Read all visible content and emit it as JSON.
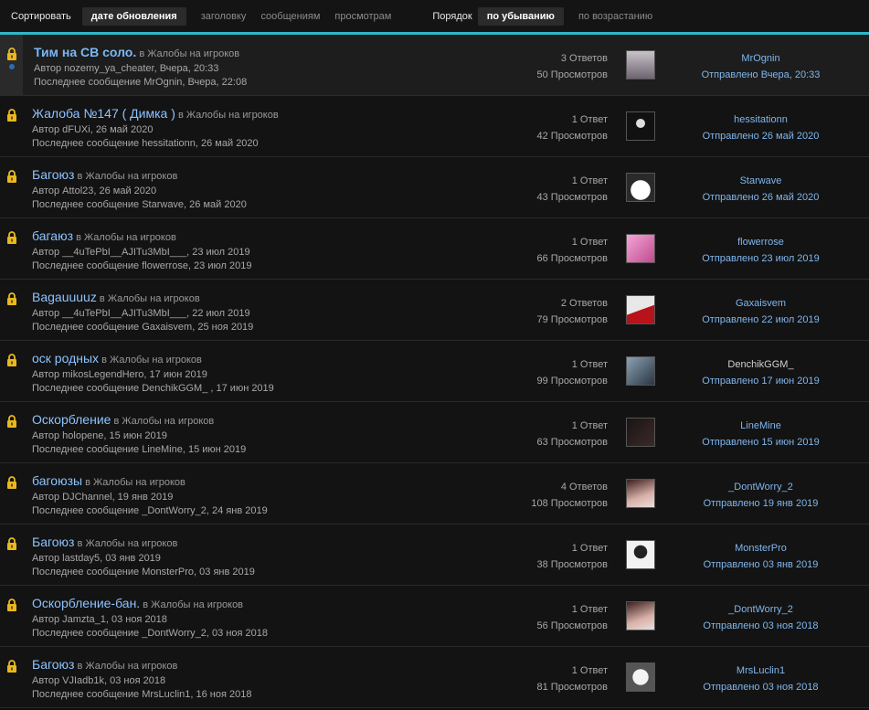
{
  "sortbar": {
    "sort_label": "Сортировать",
    "sort_options": [
      "дате обновления",
      "заголовку",
      "сообщениям",
      "просмотрам"
    ],
    "order_label": "Порядок",
    "order_options": [
      "по убыванию",
      "по возрастанию"
    ]
  },
  "colors": {
    "accent": "#2fb7c9",
    "link": "#8cc3ff",
    "background": "#131313"
  },
  "topics": [
    {
      "title": "Тим на СВ соло.",
      "forum_prefix": "в",
      "forum": "Жалобы на игроков",
      "author": "Автор nozemy_ya_cheater, Вчера, 20:33",
      "last": "Последнее сообщение MrOgnin, Вчера, 22:08",
      "replies": "3 Ответов",
      "views": "50 Просмотров",
      "last_user": "MrOgnin",
      "sent": "Отправлено Вчера, 20:33"
    },
    {
      "title": "Жалоба №147 ( Димка )",
      "forum_prefix": "в",
      "forum": "Жалобы на игроков",
      "author": "Автор dFUXi, 26 май 2020",
      "last": "Последнее сообщение hessitationn, 26 май 2020",
      "replies": "1 Ответ",
      "views": "42 Просмотров",
      "last_user": "hessitationn",
      "sent": "Отправлено 26 май 2020"
    },
    {
      "title": "Багоюз",
      "forum_prefix": "в",
      "forum": "Жалобы на игроков",
      "author": "Автор Attol23, 26 май 2020",
      "last": "Последнее сообщение Starwave, 26 май 2020",
      "replies": "1 Ответ",
      "views": "43 Просмотров",
      "last_user": "Starwave",
      "sent": "Отправлено 26 май 2020"
    },
    {
      "title": "багаюз",
      "forum_prefix": "в",
      "forum": "Жалобы на игроков",
      "author": "Автор __4uTePbI__AJITu3MbI___, 23 июл 2019",
      "last": "Последнее сообщение flowerrose, 23 июл 2019",
      "replies": "1 Ответ",
      "views": "66 Просмотров",
      "last_user": "flowerrose",
      "sent": "Отправлено 23 июл 2019"
    },
    {
      "title": "Bagauuuuz",
      "forum_prefix": "в",
      "forum": "Жалобы на игроков",
      "author": "Автор __4uTePbI__AJITu3MbI___, 22 июл 2019",
      "last": "Последнее сообщение Gaxaisvem, 25 ноя 2019",
      "replies": "2 Ответов",
      "views": "79 Просмотров",
      "last_user": "Gaxaisvem",
      "sent": "Отправлено 22 июл 2019"
    },
    {
      "title": "оск родных",
      "forum_prefix": "в",
      "forum": "Жалобы на игроков",
      "author": "Автор mikosLegendHero, 17 июн 2019",
      "last": "Последнее сообщение DenchikGGM_ , 17 июн 2019",
      "replies": "1 Ответ",
      "views": "99 Просмотров",
      "last_user": "DenchikGGM_",
      "sent": "Отправлено 17 июн 2019"
    },
    {
      "title": "Оскорбление",
      "forum_prefix": "в",
      "forum": "Жалобы на игроков",
      "author": "Автор holopene, 15 июн 2019",
      "last": "Последнее сообщение LineMine, 15 июн 2019",
      "replies": "1 Ответ",
      "views": "63 Просмотров",
      "last_user": "LineMine",
      "sent": "Отправлено 15 июн 2019"
    },
    {
      "title": "багоюзы",
      "forum_prefix": "в",
      "forum": "Жалобы на игроков",
      "author": "Автор DJChannel, 19 янв 2019",
      "last": "Последнее сообщение _DontWorry_2, 24 янв 2019",
      "replies": "4 Ответов",
      "views": "108 Просмотров",
      "last_user": "_DontWorry_2",
      "sent": "Отправлено 19 янв 2019"
    },
    {
      "title": "Багоюз",
      "forum_prefix": "в",
      "forum": "Жалобы на игроков",
      "author": "Автор lastday5, 03 янв 2019",
      "last": "Последнее сообщение MonsterPro, 03 янв 2019",
      "replies": "1 Ответ",
      "views": "38 Просмотров",
      "last_user": "MonsterPro",
      "sent": "Отправлено 03 янв 2019"
    },
    {
      "title": "Оскорбление-бан.",
      "forum_prefix": "в",
      "forum": "Жалобы на игроков",
      "author": "Автор Jamzta_1, 03 ноя 2018",
      "last": "Последнее сообщение _DontWorry_2, 03 ноя 2018",
      "replies": "1 Ответ",
      "views": "56 Просмотров",
      "last_user": "_DontWorry_2",
      "sent": "Отправлено 03 ноя 2018"
    },
    {
      "title": "Багоюз",
      "forum_prefix": "в",
      "forum": "Жалобы на игроков",
      "author": "Автор VJIadb1k, 03 ноя 2018",
      "last": "Последнее сообщение MrsLuclin1, 16 ноя 2018",
      "replies": "1 Ответ",
      "views": "81 Просмотров",
      "last_user": "MrsLuclin1",
      "sent": "Отправлено 03 ноя 2018"
    }
  ]
}
